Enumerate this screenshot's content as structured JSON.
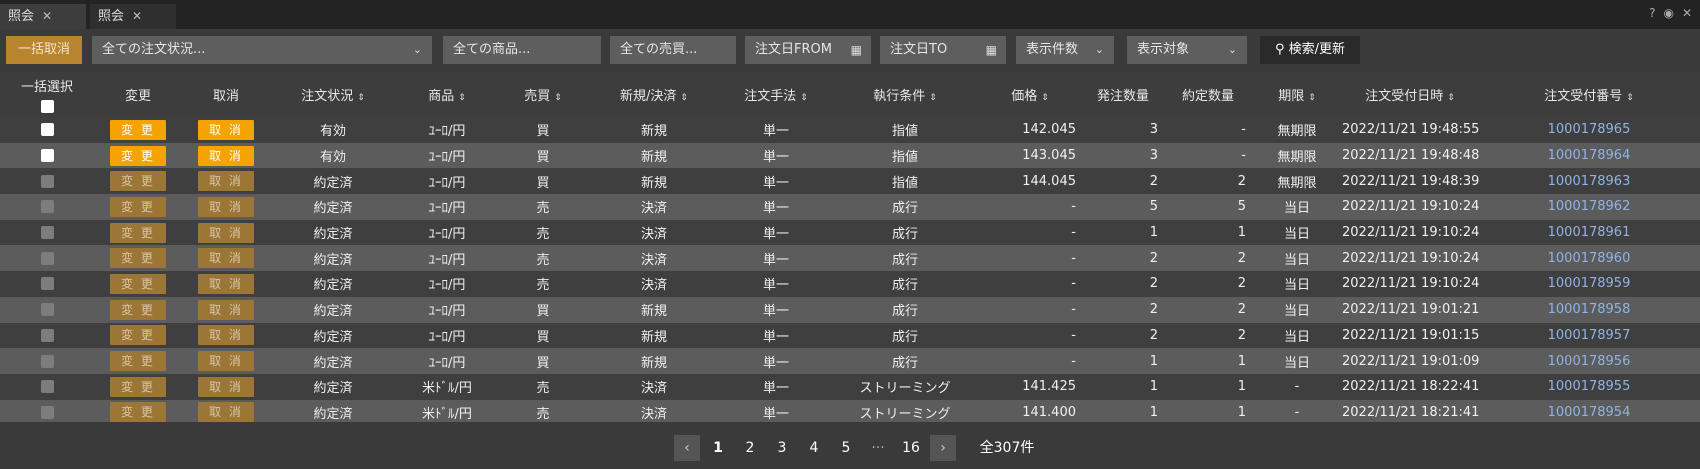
{
  "tabs": [
    {
      "label": "照会",
      "close": "✕"
    },
    {
      "label": "照会",
      "close": "✕"
    }
  ],
  "window_icons": [
    "?",
    "◉",
    "✕"
  ],
  "toolbar": {
    "bulk_cancel": "一括取消",
    "order_status_placeholder": "全ての注文状況...",
    "product_placeholder": "全ての商品...",
    "side_placeholder": "全ての売買...",
    "date_from": "注文日FROM",
    "date_to": "注文日TO",
    "display_count": "表示件数",
    "display_target": "表示対象",
    "search": "検索/更新"
  },
  "columns": {
    "bulk_select": "一括選択",
    "modify": "変更",
    "cancel": "取消",
    "status": "注文状況",
    "product": "商品",
    "side": "売買",
    "new_close": "新規/決済",
    "method": "注文手法",
    "condition": "執行条件",
    "price": "価格",
    "order_qty": "発注数量",
    "filled_qty": "約定数量",
    "expiry": "期限",
    "received_at": "注文受付日時",
    "order_no": "注文受付番号"
  },
  "button_labels": {
    "modify": "変 更",
    "cancel": "取 消"
  },
  "side_colors": {
    "buy": "#ff5a6e",
    "sell": "#26b7a0"
  },
  "rows": [
    {
      "enabled": true,
      "status": "有効",
      "product": "ﾕｰﾛ/円",
      "side": "買",
      "side_type": "buy",
      "new_close": "新規",
      "method": "単一",
      "condition": "指値",
      "price": "142.045",
      "order_qty": "3",
      "filled_qty": "-",
      "expiry": "無期限",
      "received_at": "2022/11/21 19:48:55",
      "order_no": "1000178965"
    },
    {
      "enabled": true,
      "status": "有効",
      "product": "ﾕｰﾛ/円",
      "side": "買",
      "side_type": "buy",
      "new_close": "新規",
      "method": "単一",
      "condition": "指値",
      "price": "143.045",
      "order_qty": "3",
      "filled_qty": "-",
      "expiry": "無期限",
      "received_at": "2022/11/21 19:48:48",
      "order_no": "1000178964"
    },
    {
      "enabled": false,
      "status": "約定済",
      "product": "ﾕｰﾛ/円",
      "side": "買",
      "side_type": "buy",
      "new_close": "新規",
      "method": "単一",
      "condition": "指値",
      "price": "144.045",
      "order_qty": "2",
      "filled_qty": "2",
      "expiry": "無期限",
      "received_at": "2022/11/21 19:48:39",
      "order_no": "1000178963"
    },
    {
      "enabled": false,
      "status": "約定済",
      "product": "ﾕｰﾛ/円",
      "side": "売",
      "side_type": "sell",
      "new_close": "決済",
      "method": "単一",
      "condition": "成行",
      "price": "-",
      "order_qty": "5",
      "filled_qty": "5",
      "expiry": "当日",
      "received_at": "2022/11/21 19:10:24",
      "order_no": "1000178962"
    },
    {
      "enabled": false,
      "status": "約定済",
      "product": "ﾕｰﾛ/円",
      "side": "売",
      "side_type": "sell",
      "new_close": "決済",
      "method": "単一",
      "condition": "成行",
      "price": "-",
      "order_qty": "1",
      "filled_qty": "1",
      "expiry": "当日",
      "received_at": "2022/11/21 19:10:24",
      "order_no": "1000178961"
    },
    {
      "enabled": false,
      "status": "約定済",
      "product": "ﾕｰﾛ/円",
      "side": "売",
      "side_type": "sell",
      "new_close": "決済",
      "method": "単一",
      "condition": "成行",
      "price": "-",
      "order_qty": "2",
      "filled_qty": "2",
      "expiry": "当日",
      "received_at": "2022/11/21 19:10:24",
      "order_no": "1000178960"
    },
    {
      "enabled": false,
      "status": "約定済",
      "product": "ﾕｰﾛ/円",
      "side": "売",
      "side_type": "sell",
      "new_close": "決済",
      "method": "単一",
      "condition": "成行",
      "price": "-",
      "order_qty": "2",
      "filled_qty": "2",
      "expiry": "当日",
      "received_at": "2022/11/21 19:10:24",
      "order_no": "1000178959"
    },
    {
      "enabled": false,
      "status": "約定済",
      "product": "ﾕｰﾛ/円",
      "side": "買",
      "side_type": "buy",
      "new_close": "新規",
      "method": "単一",
      "condition": "成行",
      "price": "-",
      "order_qty": "2",
      "filled_qty": "2",
      "expiry": "当日",
      "received_at": "2022/11/21 19:01:21",
      "order_no": "1000178958"
    },
    {
      "enabled": false,
      "status": "約定済",
      "product": "ﾕｰﾛ/円",
      "side": "買",
      "side_type": "buy",
      "new_close": "新規",
      "method": "単一",
      "condition": "成行",
      "price": "-",
      "order_qty": "2",
      "filled_qty": "2",
      "expiry": "当日",
      "received_at": "2022/11/21 19:01:15",
      "order_no": "1000178957"
    },
    {
      "enabled": false,
      "status": "約定済",
      "product": "ﾕｰﾛ/円",
      "side": "買",
      "side_type": "buy",
      "new_close": "新規",
      "method": "単一",
      "condition": "成行",
      "price": "-",
      "order_qty": "1",
      "filled_qty": "1",
      "expiry": "当日",
      "received_at": "2022/11/21 19:01:09",
      "order_no": "1000178956"
    },
    {
      "enabled": false,
      "status": "約定済",
      "product": "米ﾄﾞﾙ/円",
      "side": "売",
      "side_type": "sell",
      "new_close": "決済",
      "method": "単一",
      "condition": "ストリーミング",
      "price": "141.425",
      "order_qty": "1",
      "filled_qty": "1",
      "expiry": "-",
      "received_at": "2022/11/21 18:22:41",
      "order_no": "1000178955"
    },
    {
      "enabled": false,
      "status": "約定済",
      "product": "米ﾄﾞﾙ/円",
      "side": "売",
      "side_type": "sell",
      "new_close": "決済",
      "method": "単一",
      "condition": "ストリーミング",
      "price": "141.400",
      "order_qty": "1",
      "filled_qty": "1",
      "expiry": "-",
      "received_at": "2022/11/21 18:21:41",
      "order_no": "1000178954"
    }
  ],
  "pagination": {
    "prev": "‹",
    "pages": [
      "1",
      "2",
      "3",
      "4",
      "5"
    ],
    "ellipsis": "···",
    "last": "16",
    "next": "›",
    "total": "全307件",
    "current": "1"
  }
}
